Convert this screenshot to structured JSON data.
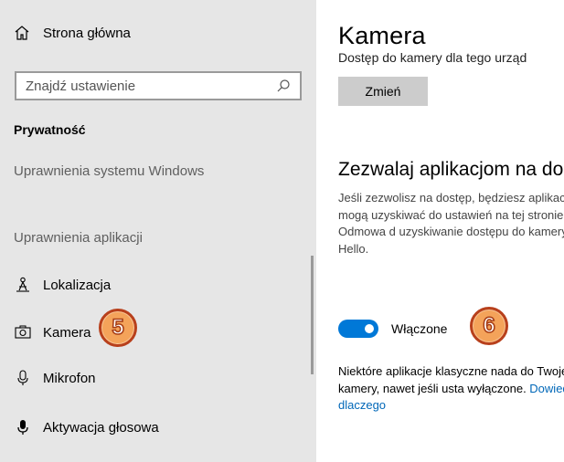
{
  "sidebar": {
    "home_label": "Strona główna",
    "search_placeholder": "Znajdź ustawienie",
    "section_heading": "Prywatność",
    "group_windows": "Uprawnienia systemu Windows",
    "group_apps": "Uprawnienia aplikacji",
    "items": [
      {
        "label": "Lokalizacja",
        "icon": "location-person-icon"
      },
      {
        "label": "Kamera",
        "icon": "camera-icon"
      },
      {
        "label": "Mikrofon",
        "icon": "microphone-icon"
      },
      {
        "label": "Aktywacja głosowa",
        "icon": "voice-activation-icon"
      }
    ]
  },
  "main": {
    "title": "Kamera",
    "cut_text": "Dostęp do kamery dla tego urząd",
    "change_button": "Zmień",
    "section_title": "Zezwalaj aplikacjom na do",
    "description": "Jeśli zezwolisz na dostęp, będziesz aplikacji, które mogą uzyskiwać do ustawień na tej stronie. Odmowa d uzyskiwanie dostępu do kamery, a Hello.",
    "toggle_label": "Włączone",
    "toggle_on": true,
    "note_text": "Niektóre aplikacje klasyczne nada do Twojej kamery, nawet jeśli usta wyłączone. ",
    "note_link": "Dowiedz się, dlaczego"
  },
  "badges": {
    "sidebar": "5",
    "toggle": "6"
  },
  "colors": {
    "accent": "#0078d7",
    "sidebar_bg": "#e6e6e6",
    "link": "#0067b8",
    "badge_fill": "#f4a35a",
    "badge_stroke": "#b8401c"
  }
}
